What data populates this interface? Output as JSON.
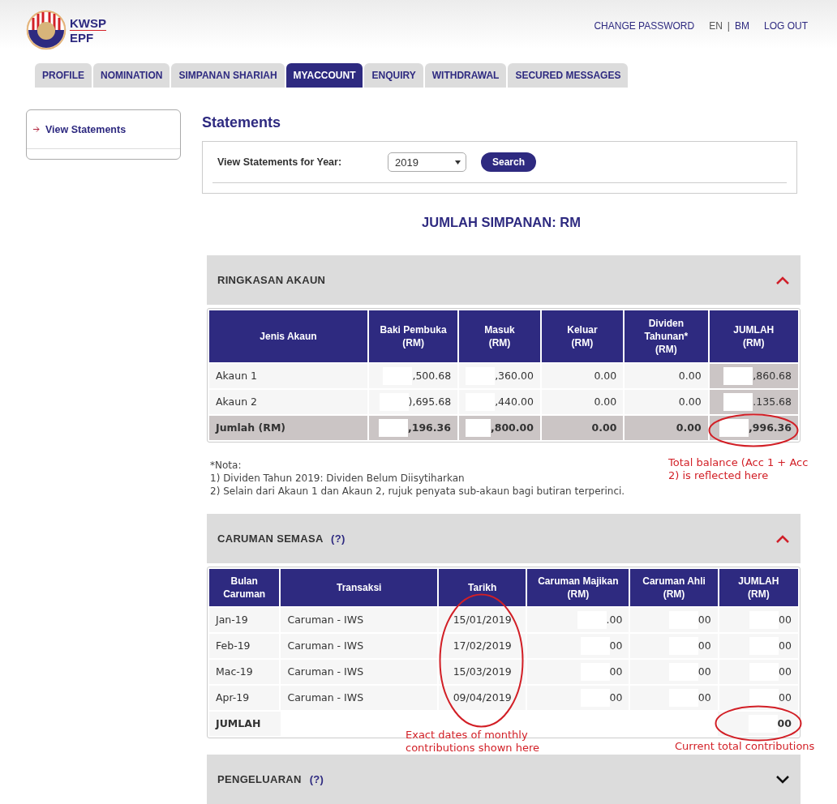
{
  "header": {
    "logo_lines": [
      "KWSP",
      "EPF"
    ],
    "links": [
      {
        "label": "CHANGE PASSWORD",
        "kind": "link"
      },
      {
        "label": "EN",
        "kind": "plain"
      },
      {
        "label": "|",
        "kind": "sep"
      },
      {
        "label": "BM",
        "kind": "link"
      },
      {
        "label": "LOG OUT",
        "kind": "link"
      }
    ]
  },
  "tabs": [
    {
      "label": "PROFILE",
      "selected": false
    },
    {
      "label": "NOMINATION",
      "selected": false
    },
    {
      "label": "SIMPANAN SHARIAH",
      "selected": false
    },
    {
      "label": "MYACCOUNT",
      "selected": true
    },
    {
      "label": "ENQUIRY",
      "selected": false
    },
    {
      "label": "WITHDRAWAL",
      "selected": false
    },
    {
      "label": "SECURED MESSAGES",
      "selected": false
    }
  ],
  "sidebar": {
    "items": [
      {
        "label": "View Statements",
        "selected": true
      }
    ]
  },
  "statements": {
    "title": "Statements",
    "year_label": "View Statements for Year:",
    "year_value": "2019",
    "search_button": "Search"
  },
  "total_heading": "JUMLAH SIMPANAN: RM",
  "summary": {
    "title": "RINGKASAN AKAUN",
    "expanded": true,
    "columns": [
      "Jenis Akaun",
      "Baki Pembuka\n(RM)",
      "Masuk\n(RM)",
      "Keluar\n(RM)",
      "Dividen\nTahunan*\n(RM)",
      "JUMLAH\n(RM)"
    ],
    "rows": [
      {
        "kind": "normal",
        "cells": [
          {
            "text": "Akaun 1",
            "masked": false
          },
          {
            "text": ",500.68",
            "masked": true
          },
          {
            "text": ",360.00",
            "masked": true
          },
          {
            "text": "0.00",
            "masked": false
          },
          {
            "text": "0.00",
            "masked": false
          },
          {
            "text": ",860.68",
            "masked": true
          }
        ]
      },
      {
        "kind": "normal",
        "cells": [
          {
            "text": "Akaun 2",
            "masked": false
          },
          {
            "text": "),695.68",
            "masked": true
          },
          {
            "text": ",440.00",
            "masked": true
          },
          {
            "text": "0.00",
            "masked": false
          },
          {
            "text": "0.00",
            "masked": false
          },
          {
            "text": ".135.68",
            "masked": true
          }
        ]
      },
      {
        "kind": "total",
        "cells": [
          {
            "text": "Jumlah (RM)",
            "masked": false
          },
          {
            "text": ",196.36",
            "masked": true
          },
          {
            "text": ",800.00",
            "masked": true
          },
          {
            "text": "0.00",
            "masked": false
          },
          {
            "text": "0.00",
            "masked": false
          },
          {
            "text": ",996.36",
            "masked": true
          }
        ]
      }
    ],
    "notes": [
      "*Nota:",
      "1) Dividen Tahun 2019: Dividen Belum Diisytiharkan",
      "2) Selain dari Akaun 1 dan Akaun 2, rujuk penyata sub-akaun bagi butiran terperinci."
    ]
  },
  "contributions": {
    "title": "CARUMAN SEMASA",
    "help": "(?)",
    "expanded": true,
    "columns": [
      "Bulan\nCaruman",
      "Transaksi",
      "Tarikh",
      "Caruman Majikan\n(RM)",
      "Caruman Ahli\n(RM)",
      "JUMLAH\n(RM)"
    ],
    "rows": [
      {
        "kind": "normal",
        "cells": [
          {
            "text": "Jan-19",
            "masked": false
          },
          {
            "text": "Caruman - IWS",
            "masked": false
          },
          {
            "text": "15/01/2019",
            "masked": false
          },
          {
            "text": ".00",
            "masked": true
          },
          {
            "text": "00",
            "masked": true
          },
          {
            "text": "00",
            "masked": true
          }
        ]
      },
      {
        "kind": "normal",
        "cells": [
          {
            "text": "Feb-19",
            "masked": false
          },
          {
            "text": "Caruman - IWS",
            "masked": false
          },
          {
            "text": "17/02/2019",
            "masked": false
          },
          {
            "text": "00",
            "masked": true
          },
          {
            "text": "00",
            "masked": true
          },
          {
            "text": "00",
            "masked": true
          }
        ]
      },
      {
        "kind": "normal",
        "cells": [
          {
            "text": "Mac-19",
            "masked": false
          },
          {
            "text": "Caruman - IWS",
            "masked": false
          },
          {
            "text": "15/03/2019",
            "masked": false
          },
          {
            "text": "00",
            "masked": true
          },
          {
            "text": "00",
            "masked": true
          },
          {
            "text": "00",
            "masked": true
          }
        ]
      },
      {
        "kind": "normal",
        "cells": [
          {
            "text": "Apr-19",
            "masked": false
          },
          {
            "text": "Caruman - IWS",
            "masked": false
          },
          {
            "text": "09/04/2019",
            "masked": false
          },
          {
            "text": "00",
            "masked": true
          },
          {
            "text": "00",
            "masked": true
          },
          {
            "text": "00",
            "masked": true
          }
        ]
      },
      {
        "kind": "total",
        "cells": [
          {
            "text": "JUMLAH",
            "masked": false
          },
          {
            "text": ""
          },
          {
            "text": ""
          },
          {
            "text": ""
          },
          {
            "text": ""
          },
          {
            "text": "00",
            "masked": true
          }
        ]
      }
    ]
  },
  "withdrawals": {
    "title": "PENGELUARAN",
    "help": "(?)",
    "expanded": false
  },
  "annotations": [
    {
      "text": "Total balance (Acc 1 + Acc 2) is reflected here"
    },
    {
      "text": "Exact dates of monthly contributions shown here"
    },
    {
      "text": "Current total contributions"
    }
  ]
}
